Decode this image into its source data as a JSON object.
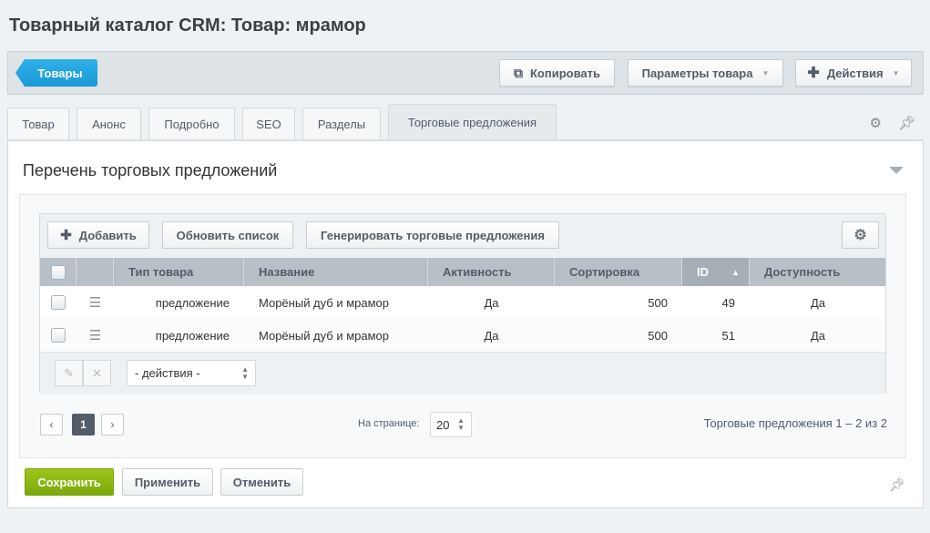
{
  "page": {
    "title": "Товарный каталог CRM: Товар: мрамор"
  },
  "toolbar": {
    "back_label": "Товары",
    "copy_label": "Копировать",
    "params_label": "Параметры товара",
    "actions_label": "Действия"
  },
  "tabs": [
    {
      "label": "Товар"
    },
    {
      "label": "Анонс"
    },
    {
      "label": "Подробно"
    },
    {
      "label": "SEO"
    },
    {
      "label": "Разделы"
    },
    {
      "label": "Торговые предложения",
      "active": true
    }
  ],
  "section": {
    "title": "Перечень торговых предложений"
  },
  "grid": {
    "add_label": "Добавить",
    "refresh_label": "Обновить список",
    "generate_label": "Генерировать торговые предложения",
    "columns": [
      "Тип товара",
      "Название",
      "Активность",
      "Сортировка",
      "ID",
      "Доступность"
    ],
    "sorted_column": "ID",
    "sort_direction": "asc",
    "rows": [
      {
        "type": "предложение",
        "name": "Морёный дуб и мрамор",
        "active": "Да",
        "sort": "500",
        "id": "49",
        "available": "Да"
      },
      {
        "type": "предложение",
        "name": "Морёный дуб и мрамор",
        "active": "Да",
        "sort": "500",
        "id": "51",
        "available": "Да"
      }
    ],
    "actions_select": "- действия -"
  },
  "pagination": {
    "current_page": "1",
    "per_page_label": "На странице:",
    "per_page_value": "20",
    "summary": "Торговые предложения 1 – 2 из 2"
  },
  "footer": {
    "save_label": "Сохранить",
    "apply_label": "Применить",
    "cancel_label": "Отменить"
  },
  "colors": {
    "accent_blue": "#1b99d6",
    "save_green": "#8bb615",
    "header_gray": "#b8c0c7"
  },
  "icons": [
    "copy-icon",
    "plus-icon",
    "chevron-down-icon",
    "gear-icon",
    "pin-icon",
    "hamburger-icon",
    "pencil-icon",
    "close-icon",
    "sort-asc-icon",
    "chevron-left-icon",
    "chevron-right-icon",
    "collapse-icon"
  ]
}
